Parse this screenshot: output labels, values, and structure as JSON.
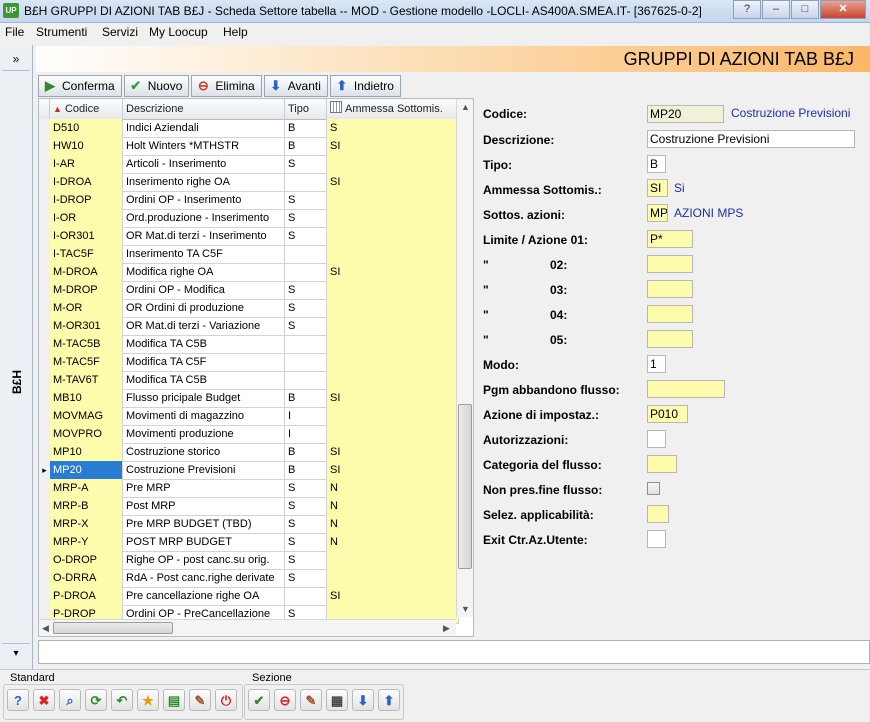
{
  "window": {
    "app_icon": "UP",
    "title": "B£H GRUPPI DI AZIONI TAB B£J - Scheda Settore tabella -- MOD - Gestione modello -LOCLI- AS400A.SMEA.IT- [367625-0-2]",
    "controls": [
      "help-icon",
      "minimize-icon",
      "maximize-icon",
      "close-icon"
    ],
    "controls_glyphs": [
      "?",
      "–",
      "□",
      "✕"
    ]
  },
  "menu": [
    "File",
    "Strumenti",
    "Servizi",
    "My Loocup",
    "Help"
  ],
  "sidebar": {
    "expand_glyph": "»",
    "label": "B£H",
    "collapse_glyph": "▾"
  },
  "header": {
    "title": "GRUPPI DI AZIONI TAB B£J"
  },
  "toolbar": [
    {
      "label": "Conferma",
      "icon": "play-green-icon",
      "glyph": "▶",
      "color": "#2e8b2e"
    },
    {
      "label": "Nuovo",
      "icon": "check-green-icon",
      "glyph": "✔",
      "color": "#3aa03a"
    },
    {
      "label": "Elimina",
      "icon": "delete-red-icon",
      "glyph": "⊖",
      "color": "#d23a2a"
    },
    {
      "label": "Avanti",
      "icon": "arrow-down-icon",
      "glyph": "⬇",
      "color": "#2d62c4"
    },
    {
      "label": "Indietro",
      "icon": "arrow-up-icon",
      "glyph": "⬆",
      "color": "#2d62c4"
    }
  ],
  "grid": {
    "columns": [
      "Codice",
      "Descrizione",
      "Tipo",
      "Ammessa  Sottomis."
    ],
    "sort_indicator": "▲",
    "rows": [
      {
        "code": "D510",
        "desc": "Indici Aziendali",
        "tipo": "B",
        "amm": "S"
      },
      {
        "code": "HW10",
        "desc": "Holt Winters  *MTHSTR",
        "tipo": "B",
        "amm": "SI"
      },
      {
        "code": "I-AR",
        "desc": "Articoli - Inserimento",
        "tipo": "S",
        "amm": ""
      },
      {
        "code": "I-DROA",
        "desc": "Inserimento righe OA",
        "tipo": "",
        "amm": "SI"
      },
      {
        "code": "I-DROP",
        "desc": "Ordini OP - Inserimento",
        "tipo": "S",
        "amm": ""
      },
      {
        "code": "I-OR",
        "desc": "Ord.produzione - Inserimento",
        "tipo": "S",
        "amm": ""
      },
      {
        "code": "I-OR301",
        "desc": "OR Mat.di terzi - Inserimento",
        "tipo": "S",
        "amm": ""
      },
      {
        "code": "I-TAC5F",
        "desc": "Inserimento TA C5F",
        "tipo": "",
        "amm": ""
      },
      {
        "code": "M-DROA",
        "desc": "Modifica righe OA",
        "tipo": "",
        "amm": "SI"
      },
      {
        "code": "M-DROP",
        "desc": "Ordini OP - Modifica",
        "tipo": "S",
        "amm": ""
      },
      {
        "code": "M-OR",
        "desc": "OR Ordini di produzione",
        "tipo": "S",
        "amm": ""
      },
      {
        "code": "M-OR301",
        "desc": "OR Mat.di terzi - Variazione",
        "tipo": "S",
        "amm": ""
      },
      {
        "code": "M-TAC5B",
        "desc": "Modifica TA C5B",
        "tipo": "",
        "amm": ""
      },
      {
        "code": "M-TAC5F",
        "desc": "Modifica TA C5F",
        "tipo": "",
        "amm": ""
      },
      {
        "code": "M-TAV6T",
        "desc": "Modifica TA C5B",
        "tipo": "",
        "amm": ""
      },
      {
        "code": "MB10",
        "desc": "Flusso pricipale Budget",
        "tipo": "B",
        "amm": "SI"
      },
      {
        "code": "MOVMAG",
        "desc": "Movimenti di magazzino",
        "tipo": "I",
        "amm": ""
      },
      {
        "code": "MOVPRO",
        "desc": "Movimenti produzione",
        "tipo": "I",
        "amm": ""
      },
      {
        "code": "MP10",
        "desc": "Costruzione storico",
        "tipo": "B",
        "amm": "SI"
      },
      {
        "code": "MP20",
        "desc": "Costruzione Previsioni",
        "tipo": "B",
        "amm": "SI",
        "selected": true
      },
      {
        "code": "MRP-A",
        "desc": "Pre MRP",
        "tipo": "S",
        "amm": "N"
      },
      {
        "code": "MRP-B",
        "desc": "Post MRP",
        "tipo": "S",
        "amm": "N"
      },
      {
        "code": "MRP-X",
        "desc": "Pre MRP BUDGET (TBD)",
        "tipo": "S",
        "amm": "N"
      },
      {
        "code": "MRP-Y",
        "desc": "POST MRP BUDGET",
        "tipo": "S",
        "amm": "N"
      },
      {
        "code": "O-DROP",
        "desc": "Righe OP - post canc.su orig.",
        "tipo": "S",
        "amm": ""
      },
      {
        "code": "O-DRRA",
        "desc": "RdA - Post canc.righe derivate",
        "tipo": "S",
        "amm": ""
      },
      {
        "code": "P-DROA",
        "desc": "Pre cancellazione righe OA",
        "tipo": "",
        "amm": "SI"
      },
      {
        "code": "P-DROP",
        "desc": "Ordini OP - PreCancellazione",
        "tipo": "S",
        "amm": ""
      }
    ]
  },
  "form": {
    "codice": {
      "label": "Codice:",
      "value": "MP20",
      "desc": "Costruzione Previsioni"
    },
    "descrizione": {
      "label": "Descrizione:",
      "value": "Costruzione Previsioni"
    },
    "tipo": {
      "label": "Tipo:",
      "value": "B"
    },
    "ammessa": {
      "label": "Ammessa  Sottomis.:",
      "value": "SI",
      "desc": "Si"
    },
    "sottos": {
      "label": "Sottos. azioni:",
      "value": "MP",
      "desc": "AZIONI MPS"
    },
    "limite01": {
      "label": "Limite / Azione 01:",
      "value": "P*"
    },
    "limite02": {
      "label_q": "\"",
      "label_n": "02:",
      "value": ""
    },
    "limite03": {
      "label_q": "\"",
      "label_n": "03:",
      "value": ""
    },
    "limite04": {
      "label_q": "\"",
      "label_n": "04:",
      "value": ""
    },
    "limite05": {
      "label_q": "\"",
      "label_n": "05:",
      "value": ""
    },
    "modo": {
      "label": "Modo:",
      "value": "1"
    },
    "pgm": {
      "label": "Pgm abbandono flusso:",
      "value": ""
    },
    "azione": {
      "label": "Azione di impostaz.:",
      "value": "P010"
    },
    "autorizzazioni": {
      "label": "Autorizzazioni:",
      "value": ""
    },
    "categoria": {
      "label": "Categoria del flusso:",
      "value": ""
    },
    "nonpres": {
      "label": "Non pres.fine flusso:",
      "checked": false
    },
    "selez": {
      "label": "Selez. applicabilità:",
      "value": ""
    },
    "exit": {
      "label": "Exit Ctr.Az.Utente:",
      "value": ""
    }
  },
  "bottom": {
    "standard_label": "Standard",
    "sezione_label": "Sezione",
    "standard_icons": [
      "help-icon",
      "close-red-icon",
      "search-icon",
      "refresh-icon",
      "back-icon",
      "favorite-star-icon",
      "export-icon",
      "wand-icon",
      "power-icon"
    ],
    "standard_glyphs": [
      "?",
      "✖",
      "⌕",
      "⟳",
      "↶",
      "★",
      "▤",
      "✎",
      "⏻"
    ],
    "sezione_icons": [
      "confirm-check-icon",
      "delete-icon",
      "edit-icon",
      "table-icon",
      "down-arrow-icon",
      "up-arrow-icon"
    ],
    "sezione_glyphs": [
      "✔",
      "⊖",
      "✎",
      "▦",
      "⬇",
      "⬆"
    ]
  }
}
